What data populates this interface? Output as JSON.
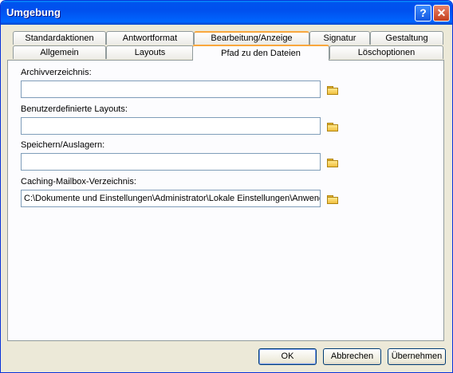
{
  "window": {
    "title": "Umgebung",
    "help_label": "?",
    "close_label": "✕"
  },
  "tabs": {
    "row1": [
      "Standardaktionen",
      "Antwortformat",
      "Bearbeitung/Anzeige",
      "Signatur",
      "Gestaltung"
    ],
    "row2": [
      "Allgemein",
      "Layouts",
      "Pfad zu den Dateien",
      "Löschoptionen"
    ],
    "active": "Pfad zu den Dateien"
  },
  "fields": [
    {
      "label": "Archivverzeichnis:",
      "value": ""
    },
    {
      "label": "Benutzerdefinierte Layouts:",
      "value": ""
    },
    {
      "label": "Speichern/Auslagern:",
      "value": ""
    },
    {
      "label": "Caching-Mailbox-Verzeichnis:",
      "value": "C:\\Dokumente und Einstellungen\\Administrator\\Lokale Einstellungen\\Anwend"
    }
  ],
  "buttons": {
    "ok": "OK",
    "cancel": "Abbrechen",
    "apply": "Übernehmen"
  },
  "colors": {
    "title_bar": "#0058e6",
    "tab_highlight": "#f9a73d",
    "field_border": "#7f9db9"
  }
}
